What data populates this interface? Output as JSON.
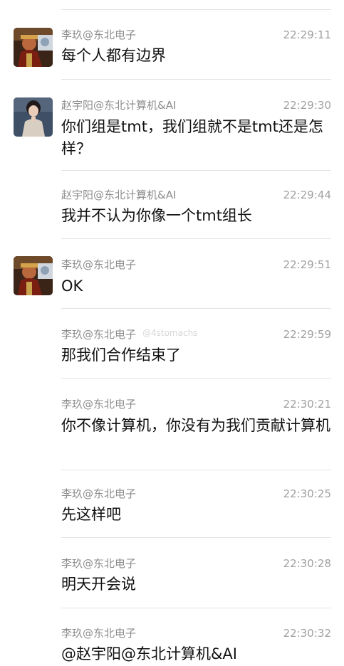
{
  "messages": [
    {
      "sender": "李玖@东北电子",
      "time": "22:29:11",
      "text": "每个人都有边界",
      "avatar": "avatar-dark-portrait"
    },
    {
      "sender": "赵宇阳@东北计算机&AI",
      "time": "22:29:30",
      "text": "你们组是tmt，我们组就不是tmt还是怎样？",
      "avatar": "avatar-person-portrait"
    },
    {
      "sender": "赵宇阳@东北计算机&AI",
      "time": "22:29:44",
      "text": "我并不认为你像一个tmt组长"
    },
    {
      "sender": "李玖@东北电子",
      "time": "22:29:51",
      "text": "OK",
      "avatar": "avatar-dark-portrait"
    },
    {
      "sender": "李玖@东北电子",
      "time": "22:29:59",
      "text": "那我们合作结束了"
    },
    {
      "sender": "李玖@东北电子",
      "time": "22:30:21",
      "text": "你不像计算机，你没有为我们贡献计算机"
    },
    {
      "sender": "李玖@东北电子",
      "time": "22:30:25",
      "text": "先这样吧"
    },
    {
      "sender": "李玖@东北电子",
      "time": "22:30:28",
      "text": "明天开会说"
    },
    {
      "sender": "李玖@东北电子",
      "time": "22:30:32",
      "text": "@赵宇阳@东北计算机&AI"
    }
  ],
  "watermark": "@4stomachs",
  "colors": {
    "sender": "#8c8c8c",
    "time": "#a0a0a0",
    "text": "#111111",
    "divider": "#e3e3e3"
  }
}
